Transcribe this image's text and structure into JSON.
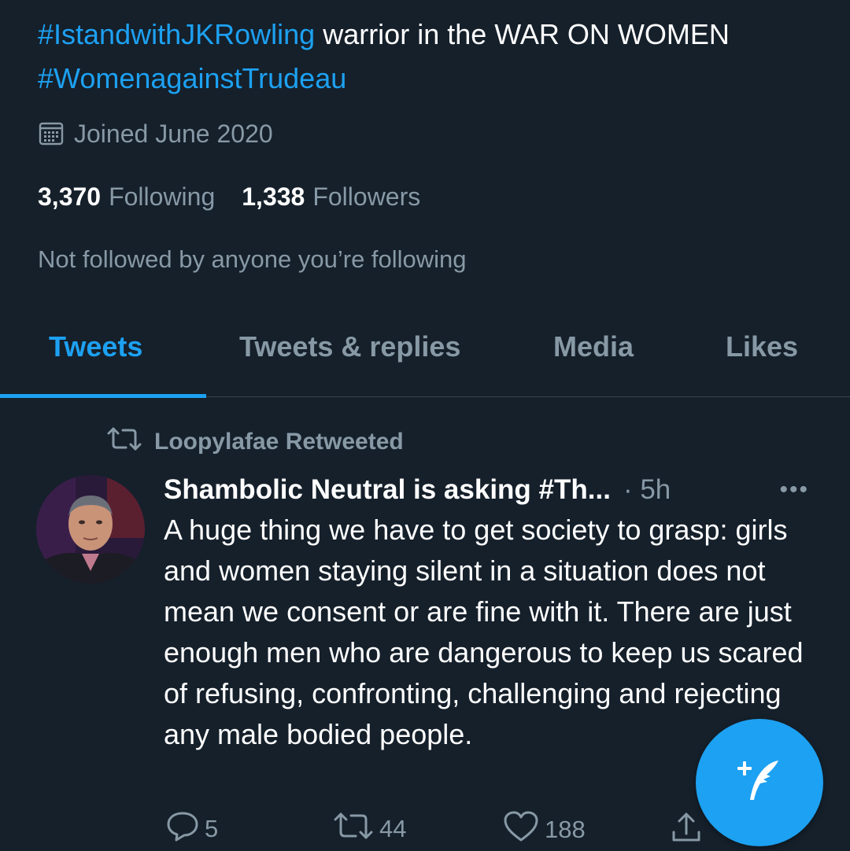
{
  "profile": {
    "bio": {
      "hashtag1": "#IstandwithJKRowling",
      "text1": " warrior in the WAR ON WOMEN ",
      "hashtag2": "#WomenagainstTrudeau"
    },
    "joined": "Joined June 2020",
    "following_count": "3,370",
    "following_label": "Following",
    "followers_count": "1,338",
    "followers_label": "Followers",
    "not_followed": "Not followed by anyone you’re following"
  },
  "tabs": [
    {
      "label": "Tweets",
      "active": true
    },
    {
      "label": "Tweets & replies",
      "active": false
    },
    {
      "label": "Media",
      "active": false
    },
    {
      "label": "Likes",
      "active": false
    }
  ],
  "tweet": {
    "retweeted_by": "Loopylafae Retweeted",
    "author": "Shambolic Neutral is asking #Th...",
    "time": "· 5h",
    "more": "•••",
    "text": "A huge thing we have to get society to grasp: girls and women staying silent in a situation does not mean we consent or are fine with it. There are just enough men who are dangerous to keep us scared of refusing, confronting, challenging and rejecting any male bodied people.",
    "replies": "5",
    "retweets": "44",
    "likes": "188"
  },
  "icons": {
    "calendar": "calendar-icon",
    "retweet": "retweet-icon",
    "reply": "reply-icon",
    "like": "heart-icon",
    "share": "share-icon",
    "compose": "compose-tweet-icon"
  },
  "colors": {
    "background": "#15202b",
    "accent": "#1da1f2",
    "secondary_text": "#8899a6",
    "divider": "#38444d"
  }
}
